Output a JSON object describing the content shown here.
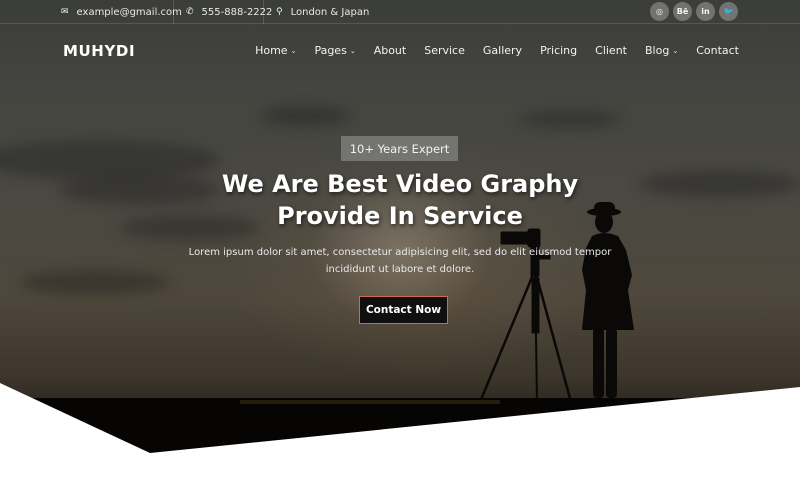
{
  "topbar": {
    "email": "example@gmail.com",
    "phone": "555-888-2222",
    "location": "London & Japan",
    "icons": {
      "email": "envelope-icon",
      "phone": "phone-icon",
      "location": "map-marker-icon"
    },
    "social": [
      {
        "name": "dribbble",
        "glyph": "◎"
      },
      {
        "name": "behance",
        "glyph": "Bē"
      },
      {
        "name": "linkedin",
        "glyph": "in"
      },
      {
        "name": "twitter",
        "glyph": "🐦"
      }
    ]
  },
  "brand": {
    "logo": "MUHYDI"
  },
  "nav": {
    "items": [
      {
        "label": "Home",
        "dropdown": true
      },
      {
        "label": "Pages",
        "dropdown": true
      },
      {
        "label": "About",
        "dropdown": false
      },
      {
        "label": "Service",
        "dropdown": false
      },
      {
        "label": "Gallery",
        "dropdown": false
      },
      {
        "label": "Pricing",
        "dropdown": false
      },
      {
        "label": "Client",
        "dropdown": false
      },
      {
        "label": "Blog",
        "dropdown": true
      },
      {
        "label": "Contact",
        "dropdown": false
      }
    ],
    "chevron": "⌄"
  },
  "hero": {
    "badge": "10+ Years Expert",
    "title_line1": "We Are Best Video Graphy",
    "title_line2": "Provide In Service",
    "description": "Lorem ipsum dolor sit amet, consectetur adipisicing elit, sed do elit eiusmod tempor incididunt ut labore et dolore.",
    "cta_label": "Contact Now"
  },
  "colors": {
    "cta_border": "#d9625c",
    "cta_bg": "#111010",
    "text": "#ffffff"
  }
}
